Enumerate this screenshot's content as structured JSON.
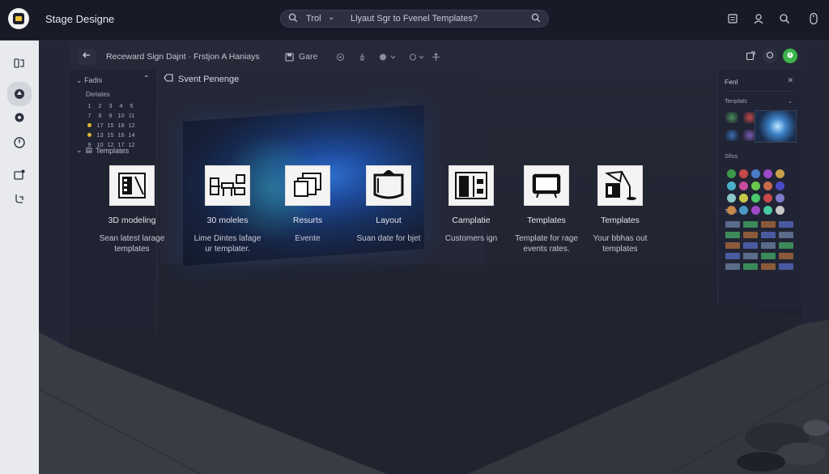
{
  "app": {
    "title": "Stage Designe"
  },
  "search": {
    "mode": "Trol",
    "query": "Llyaut Sgr to Fvenel Templates?"
  },
  "toolbar": {
    "document_title": "Receward Sign Dajnt · Frstjon A Haniays",
    "game_label": "Gare"
  },
  "left_panel": {
    "header": "Fadis",
    "subheader": "Deriates",
    "calendar_rows": [
      [
        "1",
        "2",
        "3",
        "4",
        "5"
      ],
      [
        "7",
        "8",
        "9",
        "10",
        "11"
      ],
      [
        "•",
        "17",
        "15",
        "18",
        "12"
      ],
      [
        "•",
        "13",
        "15",
        "16",
        "14"
      ],
      [
        "9",
        "10",
        "12",
        "17",
        "12"
      ]
    ],
    "templates_label": "Templates"
  },
  "panel_title": "Svent Penenge",
  "cards": [
    {
      "name": "3D modeling",
      "desc1": "Sean latest larage",
      "desc2": "templates",
      "icon": "cabinet-icon"
    },
    {
      "name": "30 moleles",
      "desc1": "Lime Dintes lafage",
      "desc2": "ur templater.",
      "icon": "furniture-icon"
    },
    {
      "name": "Resurts",
      "desc1": "Evente",
      "desc2": "",
      "icon": "documents-icon"
    },
    {
      "name": "Layout",
      "desc1": "Suan date for bjet",
      "desc2": "",
      "icon": "box-icon"
    },
    {
      "name": "Camplatie",
      "desc1": "Customers ign",
      "desc2": "",
      "icon": "shelf-icon"
    },
    {
      "name": "Templates",
      "desc1": "Template for rage",
      "desc2": "events rates.",
      "icon": "tv-icon"
    },
    {
      "name": "Templates",
      "desc1": "Your bbhas out",
      "desc2": "templates",
      "icon": "desk-lamp-icon"
    }
  ],
  "right_panel": {
    "title": "Fenl",
    "section1": "Tenplats",
    "section2": "Sfiss",
    "section3": "Tiale"
  },
  "colors": {
    "accent_green": "#3bb54a",
    "calendar_dot": "#e0b43a",
    "stage_bg": "#232634"
  }
}
